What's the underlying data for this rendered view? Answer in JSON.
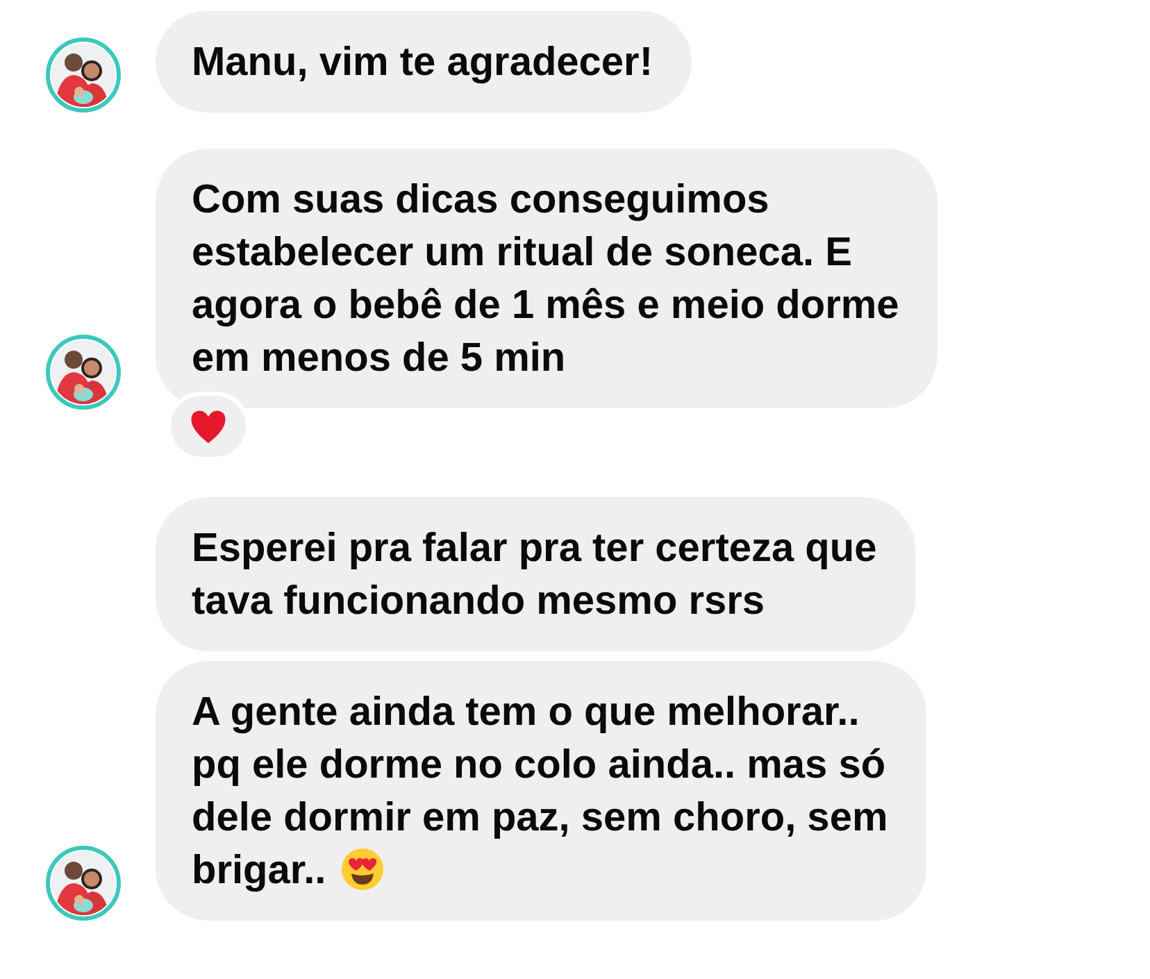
{
  "messages": [
    {
      "text": "Manu, vim te agradecer!",
      "avatar": true
    },
    {
      "text": "Com suas dicas conseguimos\nestabelecer um ritual de soneca. E\nagora o bebê de 1 mês e meio dorme\nem menos de 5 min",
      "avatar": true,
      "reaction": {
        "kind": "heart"
      }
    },
    {
      "text": "Esperei pra falar pra ter certeza que\ntava funcionando mesmo rsrs",
      "avatar": false
    },
    {
      "text": "A gente ainda tem o que melhorar..\npq ele dorme no colo ainda.. mas só\ndele dormir em paz, sem choro, sem\nbrigar..",
      "avatar": true,
      "trailing_emoji": {
        "kind": "heart_eyes"
      }
    }
  ]
}
